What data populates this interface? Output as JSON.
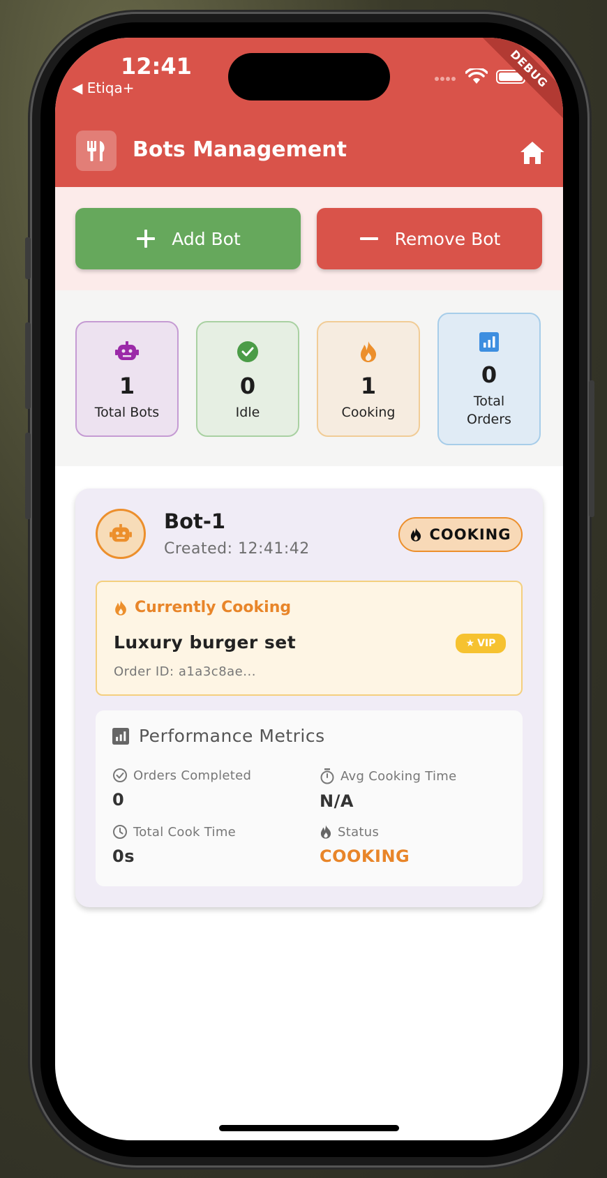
{
  "status_bar": {
    "time": "12:41",
    "back_label": "◀ Etiqa+",
    "debug_label": "DEBUG"
  },
  "appbar": {
    "title": "Bots Management",
    "logo_icon": "fork-knife-icon",
    "home_icon": "home-icon"
  },
  "actions": {
    "add_label": "Add Bot",
    "remove_label": "Remove Bot"
  },
  "stats": [
    {
      "value": "1",
      "label": "Total Bots",
      "icon": "robot-icon",
      "color": "#9b2aa8"
    },
    {
      "value": "0",
      "label": "Idle",
      "icon": "check-circle-icon",
      "color": "#4b9c47"
    },
    {
      "value": "1",
      "label": "Cooking",
      "icon": "fire-icon",
      "color": "#ec8f2c"
    },
    {
      "value": "0",
      "label": "Total Orders",
      "icon": "bar-chart-icon",
      "color": "#3d8ee0"
    }
  ],
  "bot": {
    "name": "Bot-1",
    "created": "Created: 12:41:42",
    "status_badge": "COOKING",
    "current": {
      "heading": "Currently Cooking",
      "item": "Luxury burger set",
      "vip": "VIP",
      "order_id": "Order ID: a1a3c8ae..."
    },
    "metrics": {
      "heading": "Performance Metrics",
      "orders_completed_label": "Orders Completed",
      "orders_completed_value": "0",
      "avg_time_label": "Avg Cooking Time",
      "avg_time_value": "N/A",
      "total_time_label": "Total Cook Time",
      "total_time_value": "0s",
      "status_label": "Status",
      "status_value": "COOKING"
    }
  },
  "colors": {
    "primary": "#d9534a",
    "add": "#66a85c",
    "accent": "#ec8f2c"
  }
}
